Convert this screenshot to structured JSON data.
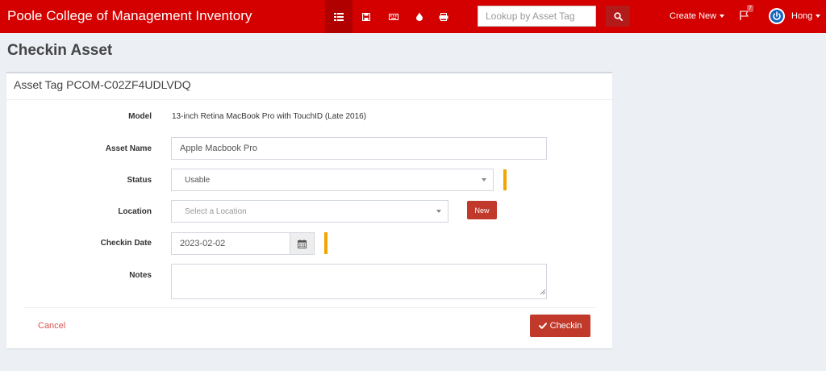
{
  "app": {
    "title": "Poole College of Management Inventory"
  },
  "nav": {
    "icons": [
      "assets-icon",
      "license-icon",
      "accessory-icon",
      "consumable-icon",
      "component-icon"
    ],
    "search_placeholder": "Lookup by Asset Tag",
    "create_new": "Create New",
    "alerts_count": "7",
    "user": "Hong"
  },
  "colors": {
    "brand": "#d40000",
    "primary_button": "#c0392b",
    "required_marker": "#f0a500"
  },
  "page": {
    "title": "Checkin Asset"
  },
  "form": {
    "heading": "Asset Tag PCOM-C02ZF4UDLVDQ",
    "model_label": "Model",
    "model_value": "13-inch Retina MacBook Pro with TouchID (Late 2016)",
    "asset_name_label": "Asset Name",
    "asset_name_value": "Apple Macbook Pro",
    "status_label": "Status",
    "status_value": "Usable",
    "location_label": "Location",
    "location_placeholder": "Select a Location",
    "new_button": "New",
    "checkin_date_label": "Checkin Date",
    "checkin_date_value": "2023-02-02",
    "notes_label": "Notes",
    "notes_value": "",
    "cancel": "Cancel",
    "submit": "Checkin"
  }
}
